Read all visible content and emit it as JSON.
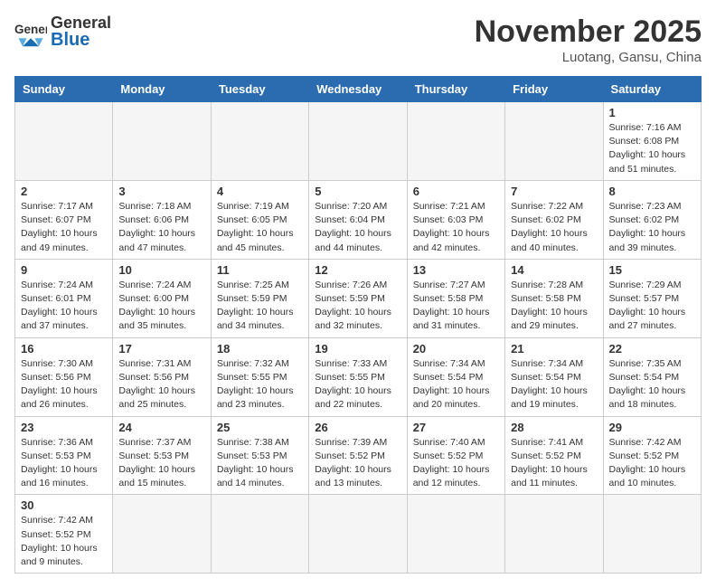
{
  "logo": {
    "text_general": "General",
    "text_blue": "Blue"
  },
  "header": {
    "month": "November 2025",
    "location": "Luotang, Gansu, China"
  },
  "weekdays": [
    "Sunday",
    "Monday",
    "Tuesday",
    "Wednesday",
    "Thursday",
    "Friday",
    "Saturday"
  ],
  "weeks": [
    [
      null,
      null,
      null,
      null,
      null,
      null,
      {
        "day": 1,
        "sunrise": "7:16 AM",
        "sunset": "6:08 PM",
        "daylight": "10 hours and 51 minutes."
      }
    ],
    [
      {
        "day": 2,
        "sunrise": "7:17 AM",
        "sunset": "6:07 PM",
        "daylight": "10 hours and 49 minutes."
      },
      {
        "day": 3,
        "sunrise": "7:18 AM",
        "sunset": "6:06 PM",
        "daylight": "10 hours and 47 minutes."
      },
      {
        "day": 4,
        "sunrise": "7:19 AM",
        "sunset": "6:05 PM",
        "daylight": "10 hours and 45 minutes."
      },
      {
        "day": 5,
        "sunrise": "7:20 AM",
        "sunset": "6:04 PM",
        "daylight": "10 hours and 44 minutes."
      },
      {
        "day": 6,
        "sunrise": "7:21 AM",
        "sunset": "6:03 PM",
        "daylight": "10 hours and 42 minutes."
      },
      {
        "day": 7,
        "sunrise": "7:22 AM",
        "sunset": "6:02 PM",
        "daylight": "10 hours and 40 minutes."
      },
      {
        "day": 8,
        "sunrise": "7:23 AM",
        "sunset": "6:02 PM",
        "daylight": "10 hours and 39 minutes."
      }
    ],
    [
      {
        "day": 9,
        "sunrise": "7:24 AM",
        "sunset": "6:01 PM",
        "daylight": "10 hours and 37 minutes."
      },
      {
        "day": 10,
        "sunrise": "7:24 AM",
        "sunset": "6:00 PM",
        "daylight": "10 hours and 35 minutes."
      },
      {
        "day": 11,
        "sunrise": "7:25 AM",
        "sunset": "5:59 PM",
        "daylight": "10 hours and 34 minutes."
      },
      {
        "day": 12,
        "sunrise": "7:26 AM",
        "sunset": "5:59 PM",
        "daylight": "10 hours and 32 minutes."
      },
      {
        "day": 13,
        "sunrise": "7:27 AM",
        "sunset": "5:58 PM",
        "daylight": "10 hours and 31 minutes."
      },
      {
        "day": 14,
        "sunrise": "7:28 AM",
        "sunset": "5:58 PM",
        "daylight": "10 hours and 29 minutes."
      },
      {
        "day": 15,
        "sunrise": "7:29 AM",
        "sunset": "5:57 PM",
        "daylight": "10 hours and 27 minutes."
      }
    ],
    [
      {
        "day": 16,
        "sunrise": "7:30 AM",
        "sunset": "5:56 PM",
        "daylight": "10 hours and 26 minutes."
      },
      {
        "day": 17,
        "sunrise": "7:31 AM",
        "sunset": "5:56 PM",
        "daylight": "10 hours and 25 minutes."
      },
      {
        "day": 18,
        "sunrise": "7:32 AM",
        "sunset": "5:55 PM",
        "daylight": "10 hours and 23 minutes."
      },
      {
        "day": 19,
        "sunrise": "7:33 AM",
        "sunset": "5:55 PM",
        "daylight": "10 hours and 22 minutes."
      },
      {
        "day": 20,
        "sunrise": "7:34 AM",
        "sunset": "5:54 PM",
        "daylight": "10 hours and 20 minutes."
      },
      {
        "day": 21,
        "sunrise": "7:34 AM",
        "sunset": "5:54 PM",
        "daylight": "10 hours and 19 minutes."
      },
      {
        "day": 22,
        "sunrise": "7:35 AM",
        "sunset": "5:54 PM",
        "daylight": "10 hours and 18 minutes."
      }
    ],
    [
      {
        "day": 23,
        "sunrise": "7:36 AM",
        "sunset": "5:53 PM",
        "daylight": "10 hours and 16 minutes."
      },
      {
        "day": 24,
        "sunrise": "7:37 AM",
        "sunset": "5:53 PM",
        "daylight": "10 hours and 15 minutes."
      },
      {
        "day": 25,
        "sunrise": "7:38 AM",
        "sunset": "5:53 PM",
        "daylight": "10 hours and 14 minutes."
      },
      {
        "day": 26,
        "sunrise": "7:39 AM",
        "sunset": "5:52 PM",
        "daylight": "10 hours and 13 minutes."
      },
      {
        "day": 27,
        "sunrise": "7:40 AM",
        "sunset": "5:52 PM",
        "daylight": "10 hours and 12 minutes."
      },
      {
        "day": 28,
        "sunrise": "7:41 AM",
        "sunset": "5:52 PM",
        "daylight": "10 hours and 11 minutes."
      },
      {
        "day": 29,
        "sunrise": "7:42 AM",
        "sunset": "5:52 PM",
        "daylight": "10 hours and 10 minutes."
      }
    ],
    [
      {
        "day": 30,
        "sunrise": "7:42 AM",
        "sunset": "5:52 PM",
        "daylight": "10 hours and 9 minutes."
      },
      null,
      null,
      null,
      null,
      null,
      null
    ]
  ]
}
